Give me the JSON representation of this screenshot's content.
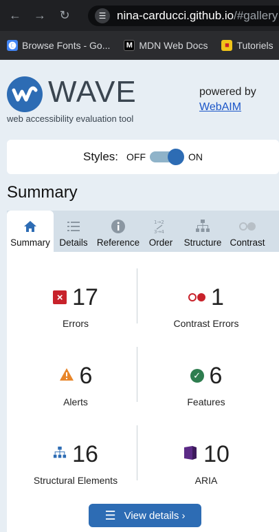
{
  "browser": {
    "url_host": "nina-carducci.github.io",
    "url_rest": "/#gallery",
    "bookmarks": [
      {
        "label": "Browse Fonts - Go...",
        "icon": "google-fonts-icon"
      },
      {
        "label": "MDN Web Docs",
        "icon": "mdn-icon"
      },
      {
        "label": "Tutoriels",
        "icon": "tutoriels-icon"
      }
    ]
  },
  "wave": {
    "logo_text": "WAVE",
    "tagline": "web accessibility evaluation tool",
    "powered_by": "powered by",
    "webaim_link": "WebAIM"
  },
  "styles_toggle": {
    "label": "Styles:",
    "off": "OFF",
    "on": "ON",
    "state": "on"
  },
  "summary_title": "Summary",
  "tabs": [
    {
      "label": "Summary",
      "icon": "home-icon",
      "active": true
    },
    {
      "label": "Details",
      "icon": "list-icon",
      "active": false
    },
    {
      "label": "Reference",
      "icon": "info-icon",
      "active": false
    },
    {
      "label": "Order",
      "icon": "order-icon",
      "active": false
    },
    {
      "label": "Structure",
      "icon": "structure-icon",
      "active": false
    },
    {
      "label": "Contrast",
      "icon": "contrast-icon",
      "active": false
    }
  ],
  "stats": {
    "errors": {
      "value": "17",
      "label": "Errors",
      "icon": "error-icon"
    },
    "contrast_errors": {
      "value": "1",
      "label": "Contrast Errors",
      "icon": "contrast-error-icon"
    },
    "alerts": {
      "value": "6",
      "label": "Alerts",
      "icon": "alert-icon"
    },
    "features": {
      "value": "6",
      "label": "Features",
      "icon": "feature-icon"
    },
    "structural": {
      "value": "16",
      "label": "Structural Elements",
      "icon": "structure-icon"
    },
    "aria": {
      "value": "10",
      "label": "ARIA",
      "icon": "aria-icon"
    }
  },
  "view_details_button": "View details ›",
  "colors": {
    "accent": "#2d6cb4",
    "error": "#c8222b",
    "alert": "#e8862a",
    "feature": "#2e7d4f",
    "aria": "#5b2a86"
  }
}
